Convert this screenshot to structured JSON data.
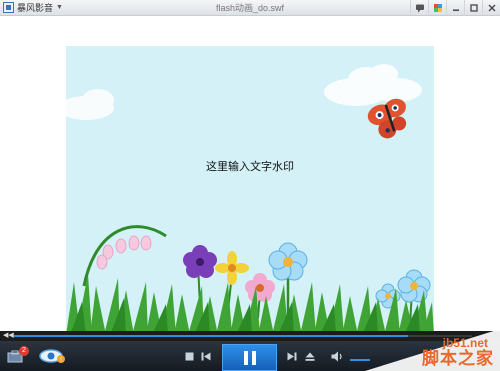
{
  "app": {
    "name": "暴风影音",
    "window_title": "flash动画_do.swf"
  },
  "video": {
    "watermark_text": "这里输入文字水印",
    "progress": 0.86
  },
  "controls": {
    "toolbox_badge": "2"
  },
  "corner_watermark": {
    "site": "jb51.net",
    "name": "脚本之家"
  },
  "colors": {
    "accent": "#2f8de4",
    "sky": "#d3f1f7",
    "controlbar": "#1c232b",
    "watermark": "#e8692a"
  }
}
